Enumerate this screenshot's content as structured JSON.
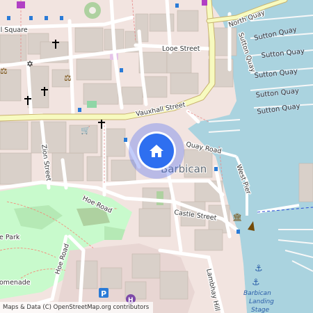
{
  "map": {
    "marker_icon": "home-icon",
    "streets": {
      "north_quay": "North Quay",
      "looe_street": "Looe Street",
      "vauxhall_street": "Vauxhall Street",
      "quay_road": "Quay Road",
      "west_pier": "West Pier",
      "hoe_road": "Hoe Road",
      "castle_street": "Castle Street",
      "zion_street": "Zion Street",
      "hoe_road_vertical": "Hoe Road",
      "lambhay_hill": "Lambhay Hill",
      "sutton_quay": "Sutton Quay",
      "square": "ll Square",
      "park": "e Park",
      "promenade": "omenade"
    },
    "quays": [
      "Sutton Quay",
      "Sutton Quay",
      "Sutton Quay",
      "Sutton Quay",
      "Sutton Quay"
    ],
    "place": "Barbican",
    "poi": {
      "landing_stage_line1": "Barbican",
      "landing_stage_line2": "Landing",
      "landing_stage_line3": "Stage"
    },
    "colors": {
      "water": "#aad3df",
      "park": "#c8facc",
      "building": "#d9d0c9",
      "major_road": "#f7fabf",
      "marker": "#2e6ff0"
    }
  },
  "attribution": "Maps & Data (C) OpenStreetMap.org contributors"
}
